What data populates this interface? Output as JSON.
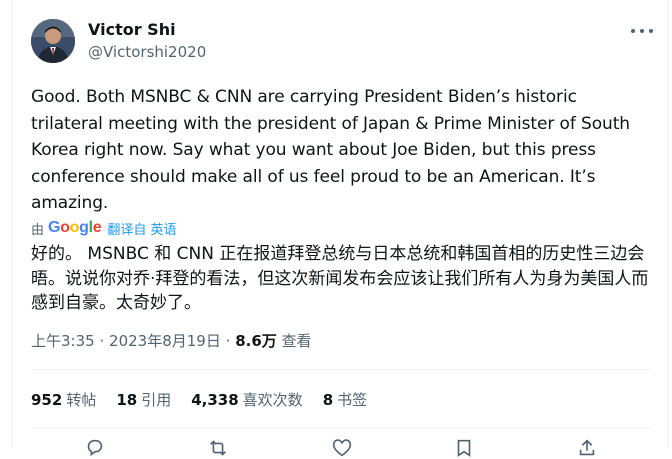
{
  "author": {
    "name": "Victor Shi",
    "handle": "@Victorshi2020"
  },
  "tweet_text": "Good. Both MSNBC & CNN are carrying President Biden’s historic trilateral meeting with the president of Japan & Prime Minister of South Korea right now. Say what you want about Joe Biden, but this press conference should make all of us feel proud to be an American. It’s amazing.",
  "translation": {
    "by_label": "由",
    "provider": "Google",
    "action_label": "翻译自 英语",
    "text": "好的。 MSNBC 和 CNN 正在报道拜登总统与日本总统和韩国首相的历史性三边会晤。说说你对乔·拜登的看法，但这次新闻发布会应该让我们所有人为身为美国人而感到自豪。太奇妙了。"
  },
  "meta": {
    "time": "上午3:35",
    "date": "2023年8月19日",
    "separator": "·",
    "views_count": "8.6万",
    "views_label": "查看"
  },
  "stats": [
    {
      "count": "952",
      "label": "转帖"
    },
    {
      "count": "18",
      "label": "引用"
    },
    {
      "count": "4,338",
      "label": "喜欢次数"
    },
    {
      "count": "8",
      "label": "书签"
    }
  ],
  "icons": {
    "more": "more-horizontal-icon",
    "reply": "reply-icon",
    "repost": "repost-icon",
    "like": "like-icon",
    "bookmark": "bookmark-icon",
    "share": "share-icon"
  },
  "colors": {
    "text": "#0f1419",
    "secondary": "#536471",
    "link": "#1d9bf0",
    "divider": "#eff3f4"
  }
}
